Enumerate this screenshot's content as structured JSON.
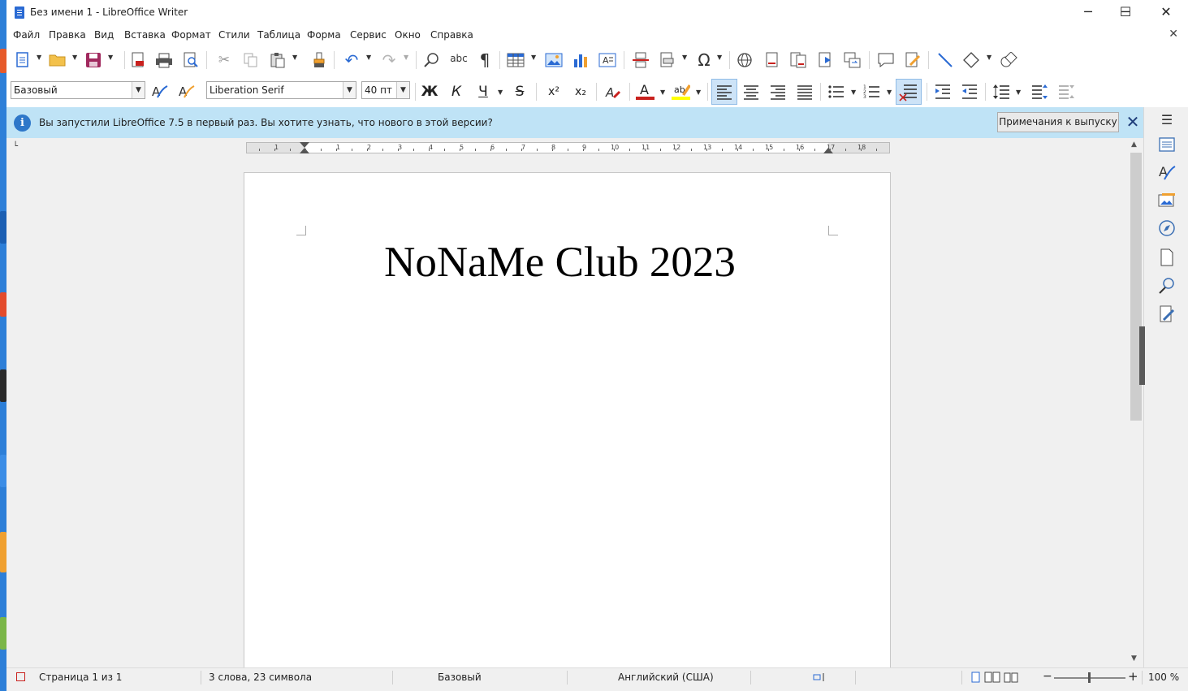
{
  "window": {
    "title": "Без имени 1 - LibreOffice Writer",
    "minimize": "─",
    "maximize": "☐",
    "close": "✕"
  },
  "menu": {
    "items": [
      "Файл",
      "Правка",
      "Вид",
      "Вставка",
      "Формат",
      "Стили",
      "Таблица",
      "Форма",
      "Сервис",
      "Окно",
      "Справка"
    ],
    "close": "✕"
  },
  "toolbar": {
    "icons": [
      "new-document-icon",
      "open-folder-icon",
      "save-icon",
      "export-pdf-icon",
      "print-icon",
      "print-preview-icon",
      "cut-icon",
      "copy-icon",
      "paste-icon",
      "clone-formatting-icon",
      "undo-icon",
      "redo-icon",
      "find-replace-icon",
      "spellcheck-icon",
      "formatting-marks-icon",
      "insert-table-icon",
      "insert-image-icon",
      "insert-chart-icon",
      "insert-textbox-icon",
      "page-break-icon",
      "insert-field-icon",
      "special-character-icon",
      "hyperlink-icon",
      "footnote-icon",
      "endnote-icon",
      "bookmark-icon",
      "cross-reference-icon",
      "comment-icon",
      "track-changes-icon",
      "line-icon",
      "basic-shapes-icon",
      "draw-functions-icon"
    ],
    "paragraph_style": "Базовый",
    "font_name": "Liberation Serif",
    "font_size": "40 пт",
    "bold": "Ж",
    "italic": "К",
    "underline": "Ч",
    "strike": "S",
    "superscript": "x²",
    "subscript": "x₂"
  },
  "infobar": {
    "icon": "i",
    "message": "Вы запустили LibreOffice 7.5 в первый раз. Вы хотите узнать, что нового в этой версии?",
    "button": "Примечания к выпуску",
    "close": "✕"
  },
  "ruler": {
    "numbers": [
      "1",
      "1",
      "2",
      "3",
      "4",
      "5",
      "6",
      "7",
      "8",
      "9",
      "10",
      "11",
      "12",
      "13",
      "14",
      "15",
      "16",
      "17",
      "18"
    ]
  },
  "document": {
    "text": "NoNaMe Club 2023"
  },
  "sidebar": {
    "icons": [
      "menu-icon",
      "properties-icon",
      "styles-icon",
      "gallery-icon",
      "navigator-icon",
      "page-icon",
      "style-inspector-icon",
      "manage-changes-icon"
    ]
  },
  "status": {
    "page": "Страница 1 из 1",
    "words": "3 слова, 23 символа",
    "style": "Базовый",
    "language": "Английский (США)",
    "zoom_minus": "−",
    "zoom_plus": "+",
    "zoom": "100 %",
    "zoom_value": 100
  },
  "colors": {
    "accent": "#2e77c9",
    "infobar": "#bfe3f6",
    "font_color": "#c9211e",
    "highlight": "#ffff00"
  }
}
